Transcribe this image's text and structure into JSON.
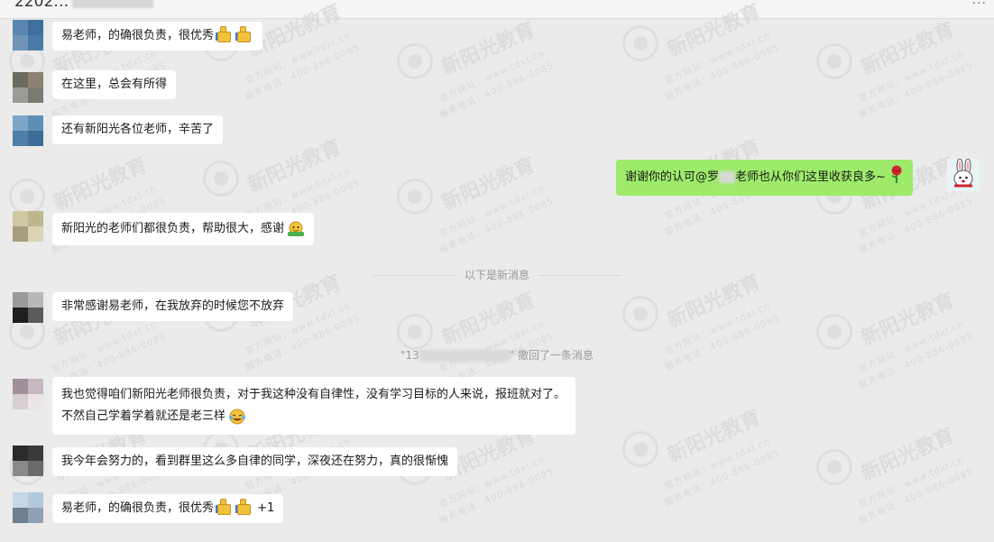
{
  "window": {
    "title": "2202…"
  },
  "watermark": {
    "brand": "新阳光教育",
    "site": "官方网站：www.tdxl.cn",
    "phone": "服务电话：400-886-0085"
  },
  "messages": [
    {
      "id": "m1",
      "text": "易老师，的确很负责，很优秀"
    },
    {
      "id": "m2",
      "text": "在这里，总会有所得"
    },
    {
      "id": "m3",
      "text": "还有新阳光各位老师，辛苦了"
    },
    {
      "id": "m4",
      "text_a": "谢谢你的认可@罗",
      "text_b": "老师也从你们这里收获良多~"
    },
    {
      "id": "m5",
      "text": "新阳光的老师们都很负责，帮助很大，感谢"
    },
    {
      "id": "m6",
      "text": "非常感谢易老师，在我放弃的时候您不放弃"
    },
    {
      "id": "m7",
      "text": "我也觉得咱们新阳光老师很负责，对于我这种没有自律性，没有学习目标的人来说，报班就对了。不然自己学着学着就还是老三样"
    },
    {
      "id": "m8",
      "text": "我今年会努力的，看到群里这么多自律的同学，深夜还在努力，真的很惭愧"
    },
    {
      "id": "m9",
      "text": "易老师，的确很负责，很优秀",
      "suffix": "+1"
    }
  ],
  "separator": {
    "label": "以下是新消息"
  },
  "recall": {
    "prefix": "\"13",
    "suffix": "\" 撤回了一条消息"
  },
  "colors": {
    "background": "#ebebeb",
    "bubble_other": "#ffffff",
    "bubble_mine": "#9eea6a"
  }
}
